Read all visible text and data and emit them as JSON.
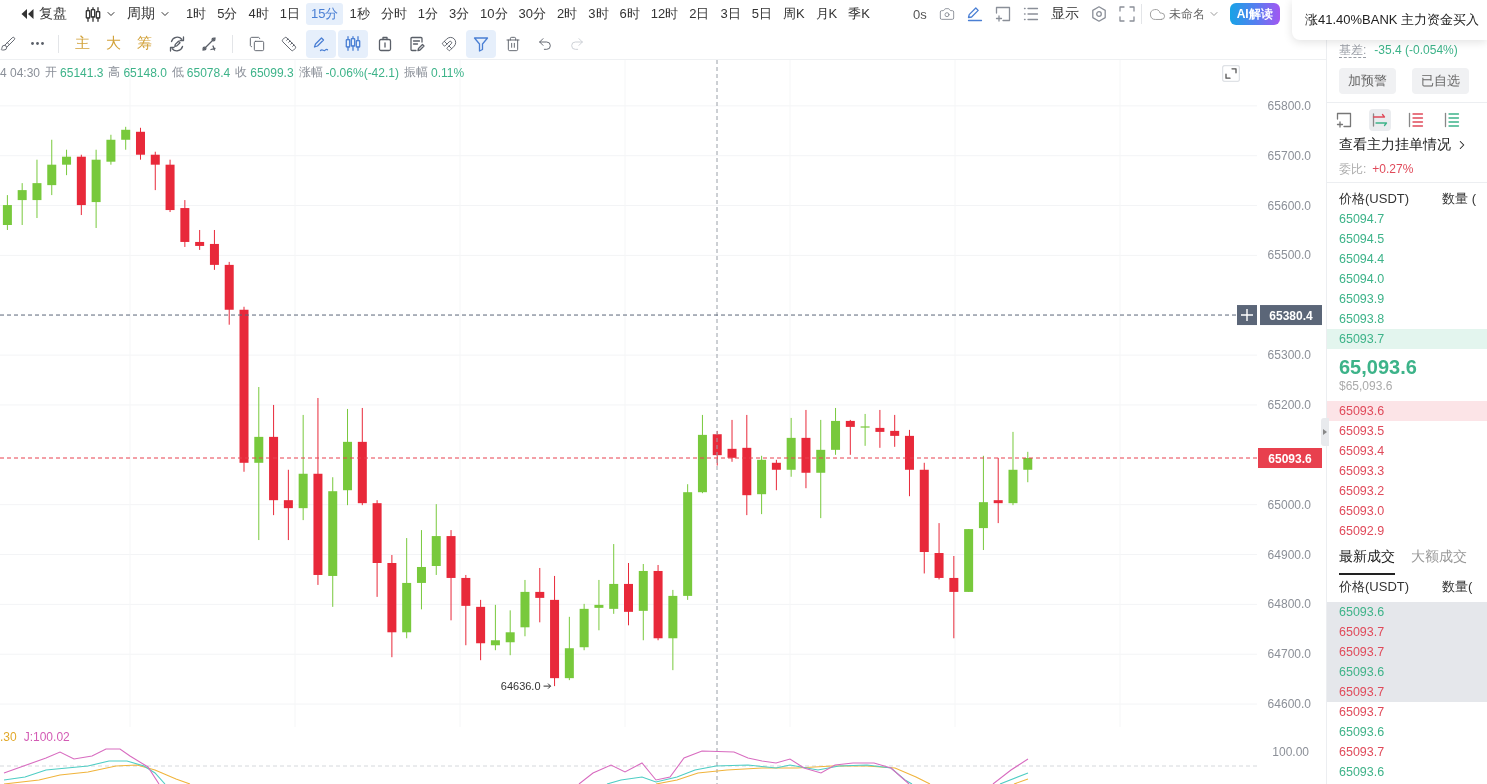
{
  "top_bar": {
    "replay_label": "复盘",
    "period_label": "周期",
    "intervals": [
      {
        "label": "1时",
        "selected": false
      },
      {
        "label": "5分",
        "selected": false
      },
      {
        "label": "4时",
        "selected": false
      },
      {
        "label": "1日",
        "selected": false
      },
      {
        "label": "15分",
        "selected": true
      },
      {
        "label": "1秒",
        "selected": false
      },
      {
        "label": "分时",
        "selected": false
      },
      {
        "label": "1分",
        "selected": false
      },
      {
        "label": "3分",
        "selected": false
      },
      {
        "label": "10分",
        "selected": false
      },
      {
        "label": "30分",
        "selected": false
      },
      {
        "label": "2时",
        "selected": false
      },
      {
        "label": "3时",
        "selected": false
      },
      {
        "label": "6时",
        "selected": false
      },
      {
        "label": "12时",
        "selected": false
      },
      {
        "label": "2日",
        "selected": false
      },
      {
        "label": "3日",
        "selected": false
      },
      {
        "label": "5日",
        "selected": false
      },
      {
        "label": "周K",
        "selected": false
      },
      {
        "label": "月K",
        "selected": false
      },
      {
        "label": "季K",
        "selected": false
      }
    ],
    "refresh": "0s",
    "display_label": "显示",
    "layout_name": "未命名",
    "ai_button": "AI解读"
  },
  "notification": {
    "text": "涨41.40%BANK 主力资金买入"
  },
  "drawing_toolbar": {
    "lead_tools": [
      {
        "selected": false,
        "disabled": false
      },
      {
        "selected": false,
        "disabled": false
      }
    ],
    "indicator_buttons": [
      "主",
      "大",
      "筹"
    ],
    "chart_tools": [
      {
        "selected": false,
        "disabled": false
      },
      {
        "selected": false,
        "disabled": false
      }
    ],
    "draw_tools": [
      {
        "selected": false,
        "disabled": false
      },
      {
        "selected": false,
        "disabled": false
      },
      {
        "selected": true,
        "disabled": false
      },
      {
        "selected": true,
        "disabled": false
      },
      {
        "selected": false,
        "disabled": false
      },
      {
        "selected": false,
        "disabled": false
      },
      {
        "selected": false,
        "disabled": false
      },
      {
        "selected": true,
        "disabled": false
      },
      {
        "selected": false,
        "disabled": false
      },
      {
        "selected": false,
        "disabled": false
      },
      {
        "selected": false,
        "disabled": true
      }
    ]
  },
  "ohlc_info": {
    "time": "4 04:30",
    "fields": [
      {
        "label": "开",
        "value": "65141.3"
      },
      {
        "label": "高",
        "value": "65148.0"
      },
      {
        "label": "低",
        "value": "65078.4"
      },
      {
        "label": "收",
        "value": "65099.3"
      },
      {
        "label": "涨幅",
        "value": "-0.06%(-42.1)"
      },
      {
        "label": "振幅",
        "value": "0.11%"
      }
    ]
  },
  "chart": {
    "chart_data": [
      {
        "type": "candlestick",
        "categories": [
          null,
          null,
          null,
          null,
          null,
          null,
          null,
          null,
          null,
          null,
          null,
          null,
          null,
          null,
          null,
          null,
          null,
          null,
          null,
          null,
          null,
          null,
          null,
          null,
          null,
          null,
          null,
          null,
          null,
          null,
          null,
          null,
          null,
          null,
          null,
          null,
          null,
          null,
          null,
          null,
          null,
          null,
          null,
          null,
          null,
          null,
          null,
          null,
          null,
          null,
          null,
          null,
          null,
          null,
          null,
          null,
          null,
          null,
          null,
          null,
          null,
          null,
          null,
          null,
          null,
          null,
          null,
          null,
          null,
          null,
          null,
          null,
          null,
          null,
          null,
          null,
          null,
          null,
          null,
          null,
          null,
          null,
          null,
          null,
          null
        ],
        "ohlc": [
          [
            65561,
            65621,
            65551,
            65601
          ],
          [
            65611,
            65645,
            65561,
            65631
          ],
          [
            65611,
            65692,
            65575,
            65645
          ],
          [
            65641,
            65732,
            65621,
            65682
          ],
          [
            65682,
            65712,
            65661,
            65698
          ],
          [
            65698,
            65702,
            65581,
            65601
          ],
          [
            65607,
            65712,
            65555,
            65692
          ],
          [
            65688,
            65742,
            65682,
            65732
          ],
          [
            65732,
            65758,
            65712,
            65752
          ],
          [
            65748,
            65756,
            65692,
            65702
          ],
          [
            65702,
            65708,
            65631,
            65682
          ],
          [
            65682,
            65692,
            65587,
            65591
          ],
          [
            65595,
            65611,
            65517,
            65527
          ],
          [
            65527,
            65551,
            65511,
            65519
          ],
          [
            65523,
            65551,
            65471,
            65481
          ],
          [
            65481,
            65487,
            65361,
            65391
          ],
          [
            65391,
            65397,
            65066,
            65084
          ],
          [
            65084,
            65236,
            64929,
            65136
          ],
          [
            65136,
            65200,
            64979,
            65009
          ],
          [
            65009,
            65070,
            64929,
            64993
          ],
          [
            64993,
            65180,
            64969,
            65062
          ],
          [
            65062,
            65214,
            64839,
            64859
          ],
          [
            64857,
            65055,
            64795,
            65027
          ],
          [
            65029,
            65192,
            64999,
            65126
          ],
          [
            65126,
            65194,
            64999,
            65003
          ],
          [
            65003,
            65009,
            64815,
            64883
          ],
          [
            64883,
            64899,
            64694,
            64744
          ],
          [
            64744,
            64933,
            64732,
            64843
          ],
          [
            64843,
            64949,
            64790,
            64875
          ],
          [
            64877,
            65001,
            64859,
            64937
          ],
          [
            64937,
            64949,
            64768,
            64853
          ],
          [
            64853,
            64859,
            64718,
            64797
          ],
          [
            64795,
            64809,
            64688,
            64722
          ],
          [
            64718,
            64799,
            64708,
            64728
          ],
          [
            64724,
            64788,
            64698,
            64744
          ],
          [
            64754,
            64849,
            64736,
            64825
          ],
          [
            64825,
            64873,
            64764,
            64813
          ],
          [
            64809,
            64857,
            64636,
            64652
          ],
          [
            64652,
            64775,
            64648,
            64712
          ],
          [
            64714,
            64801,
            64708,
            64791
          ],
          [
            64793,
            64849,
            64748,
            64799
          ],
          [
            64791,
            64921,
            64781,
            64841
          ],
          [
            64841,
            64883,
            64758,
            64785
          ],
          [
            64787,
            64881,
            64728,
            64867
          ],
          [
            64867,
            64879,
            64728,
            64732
          ],
          [
            64732,
            64829,
            64668,
            64817
          ],
          [
            64817,
            65041,
            64809,
            65025
          ],
          [
            65025,
            65180,
            65023,
            65140
          ],
          [
            65141.3,
            65148.0,
            65078.4,
            65099.3
          ],
          [
            65112,
            65170,
            65086,
            65094
          ],
          [
            65114,
            65180,
            64979,
            65019
          ],
          [
            65021,
            65098,
            64981,
            65090
          ],
          [
            65084,
            65090,
            65029,
            65070
          ],
          [
            65070,
            65174,
            65056,
            65134
          ],
          [
            65134,
            65190,
            65033,
            65064
          ],
          [
            65064,
            65170,
            64973,
            65110
          ],
          [
            65110,
            65194,
            65100,
            65168
          ],
          [
            65168,
            65170,
            65100,
            65156
          ],
          [
            65155,
            65182,
            65118,
            65157
          ],
          [
            65154,
            65190,
            65114,
            65146
          ],
          [
            65148,
            65180,
            65116,
            65138
          ],
          [
            65138,
            65150,
            65017,
            65070
          ],
          [
            65070,
            65084,
            64862,
            64905
          ],
          [
            64903,
            64963,
            64850,
            64853
          ],
          [
            64853,
            64897,
            64732,
            64825
          ],
          [
            64825,
            64951,
            64825,
            64951
          ],
          [
            64953,
            65098,
            64909,
            65005
          ],
          [
            65009,
            65094,
            64963,
            65003
          ],
          [
            65003,
            65146,
            64999,
            65070
          ],
          [
            65070,
            65106,
            65045,
            65093.6
          ],
          null,
          null,
          null,
          null,
          null,
          null,
          null,
          null,
          null,
          null,
          null,
          null,
          null,
          null,
          null
        ],
        "ylim": [
          64554,
          65892
        ],
        "yticks": [
          {
            "value": 64600,
            "label": "64600.0"
          },
          {
            "value": 64700,
            "label": "64700.0"
          },
          {
            "value": 64800,
            "label": "64800.0"
          },
          {
            "value": 64900,
            "label": "64900.0"
          },
          {
            "value": 65000,
            "label": "65000.0"
          },
          {
            "value": 65200,
            "label": "65200.0"
          },
          {
            "value": 65300,
            "label": "65300.0"
          },
          {
            "value": 65500,
            "label": "65500.0"
          },
          {
            "value": 65600,
            "label": "65600.0"
          },
          {
            "value": 65700,
            "label": "65700.0"
          },
          {
            "value": 65800,
            "label": "65800.0"
          }
        ],
        "grid": true,
        "ref_lines": [
          {
            "axis": "y",
            "value": 65380.4,
            "label": "65380.4",
            "color": "#5b6678",
            "line_style": "dashed"
          },
          {
            "axis": "y",
            "value": 65093.6,
            "label": "65093.6",
            "color": "#e8404e",
            "line_style": "dashed"
          }
        ],
        "annotations": [
          "64636.0"
        ]
      }
    ]
  },
  "indicator": {
    "labels": [
      {
        "text": ".30",
        "color": "#e2a92b"
      },
      {
        "text": "J:100.02",
        "color": "#d35bb4"
      }
    ],
    "axis_label": "100.00"
  },
  "market_panel": {
    "basis_label": "基差:",
    "basis_value": "-35.4 (-0.054%)",
    "buttons": [
      "加预警",
      "已自选"
    ],
    "view_modes": [
      {
        "selected": false
      },
      {
        "selected": true
      },
      {
        "selected": false
      },
      {
        "selected": false
      }
    ],
    "depth_link": "查看主力挂单情况",
    "ratio_label": "委比:",
    "ratio_value": "+0.27%"
  },
  "order_book": {
    "columns": [
      "价格(USDT)",
      "数量 ("
    ],
    "asks": [
      {
        "price": "65094.7",
        "highlighted": false
      },
      {
        "price": "65094.5",
        "highlighted": false
      },
      {
        "price": "65094.4",
        "highlighted": false
      },
      {
        "price": "65094.0",
        "highlighted": false
      },
      {
        "price": "65093.9",
        "highlighted": false
      },
      {
        "price": "65093.8",
        "highlighted": false
      },
      {
        "price": "65093.7",
        "highlighted": true
      }
    ],
    "last_price": "65,093.6",
    "last_price_usd": "$65,093.6",
    "bids": [
      {
        "price": "65093.6",
        "highlighted": true
      },
      {
        "price": "65093.5",
        "highlighted": false
      },
      {
        "price": "65093.4",
        "highlighted": false
      },
      {
        "price": "65093.3",
        "highlighted": false
      },
      {
        "price": "65093.2",
        "highlighted": false
      },
      {
        "price": "65093.0",
        "highlighted": false
      },
      {
        "price": "65092.9",
        "highlighted": false
      }
    ]
  },
  "trades": {
    "tabs": [
      {
        "label": "最新成交",
        "selected": true
      },
      {
        "label": "大额成交",
        "selected": false
      }
    ],
    "columns": [
      "价格(USDT)",
      "数量("
    ],
    "rows": [
      {
        "price": "65093.6",
        "color": "#3db389",
        "highlighted": true
      },
      {
        "price": "65093.7",
        "color": "#e04a5a",
        "highlighted": true
      },
      {
        "price": "65093.7",
        "color": "#e04a5a",
        "highlighted": true
      },
      {
        "price": "65093.6",
        "color": "#3db389",
        "highlighted": true
      },
      {
        "price": "65093.7",
        "color": "#e04a5a",
        "highlighted": true
      },
      {
        "price": "65093.7",
        "color": "#e04a5a",
        "highlighted": false
      },
      {
        "price": "65093.6",
        "color": "#3db389",
        "highlighted": false
      },
      {
        "price": "65093.7",
        "color": "#e04a5a",
        "highlighted": false
      },
      {
        "price": "65093.6",
        "color": "#3db389",
        "highlighted": false
      }
    ]
  }
}
